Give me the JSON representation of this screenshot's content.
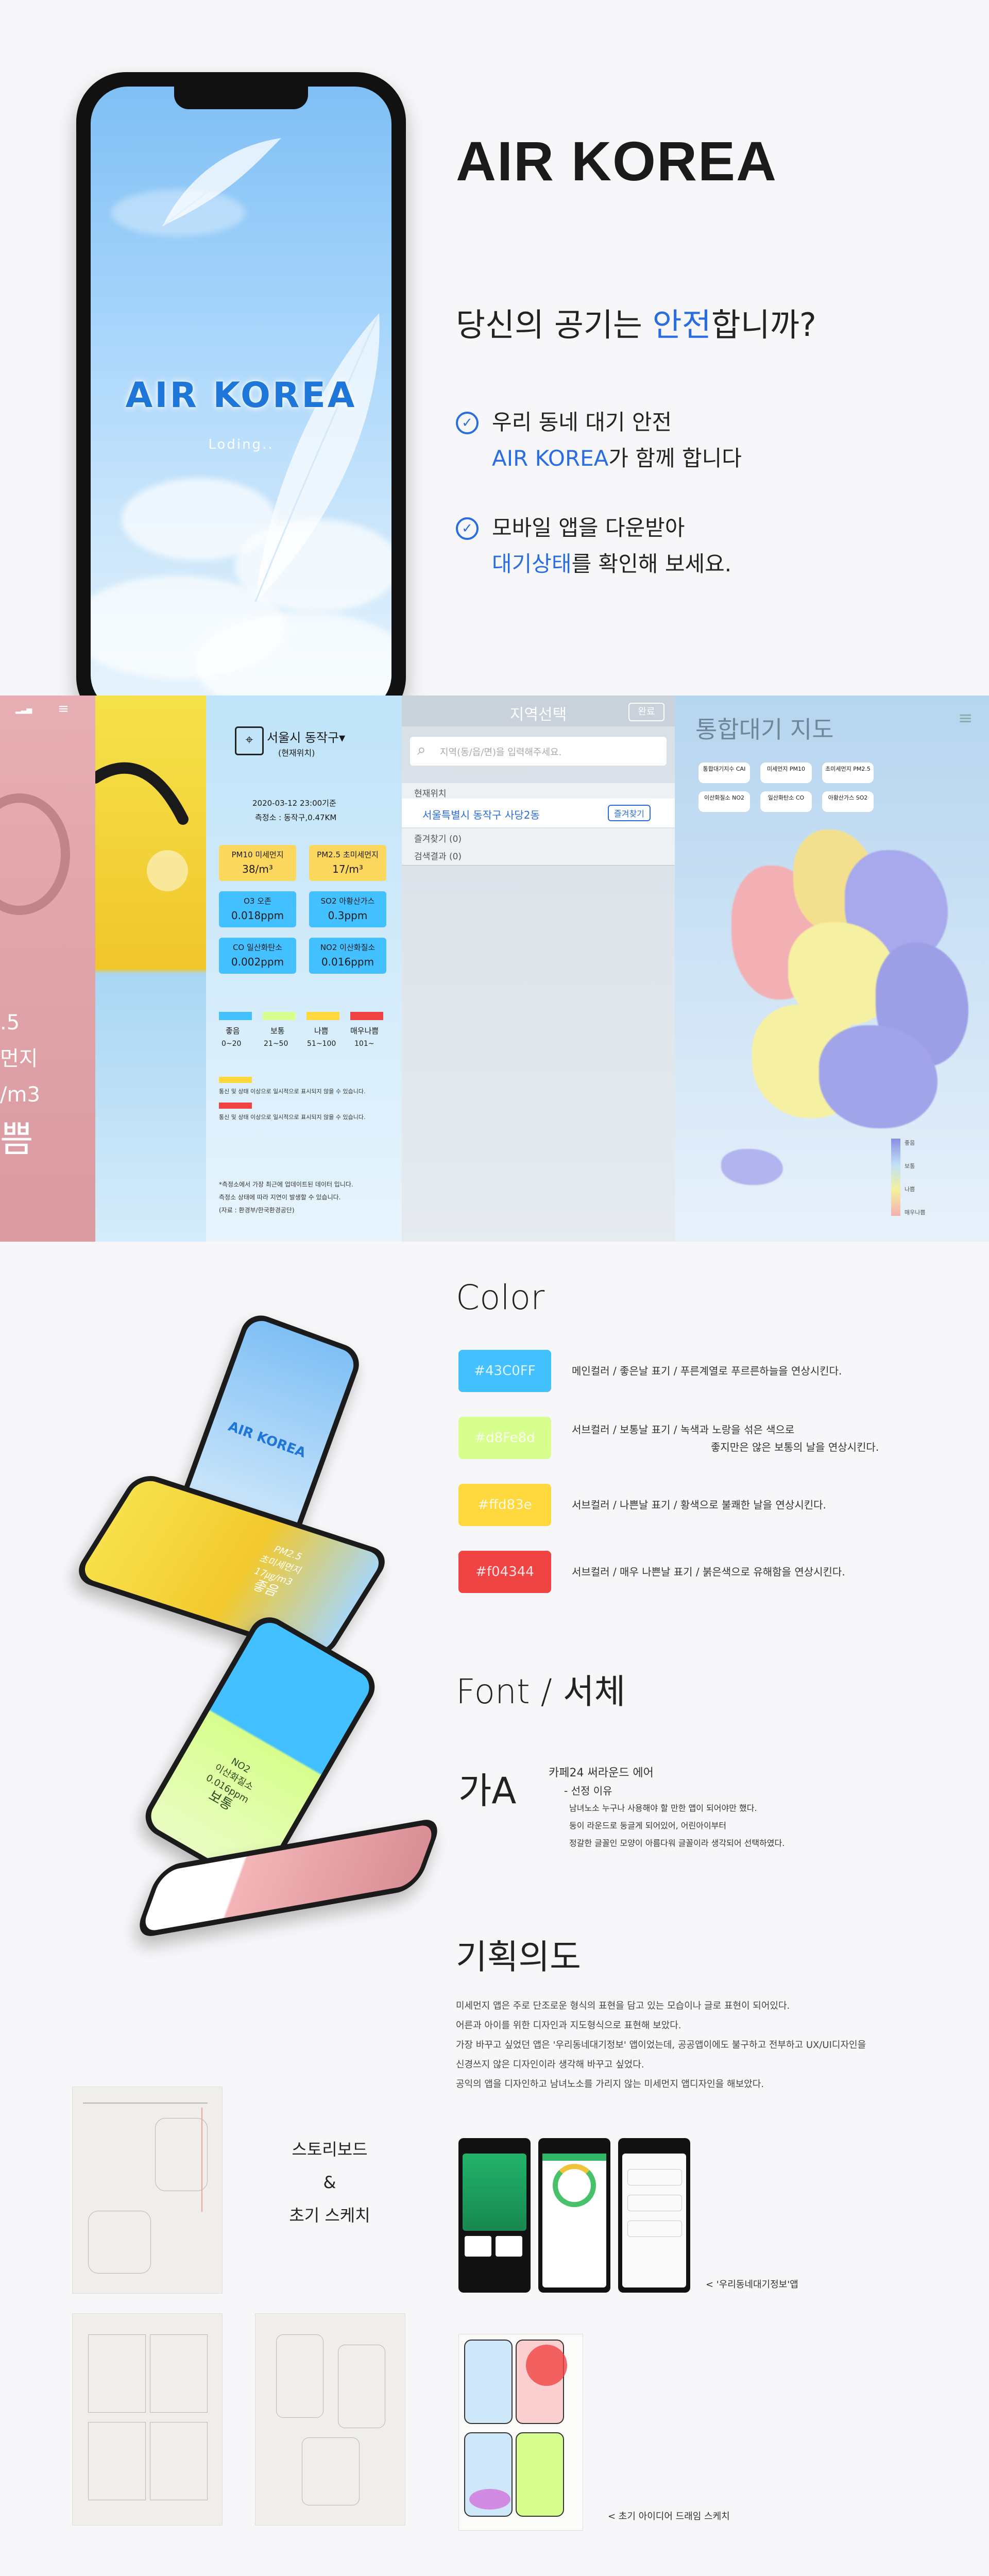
{
  "hero": {
    "app_logo": "AIR KOREA",
    "loading_text": "Loding..",
    "title": "AIR KOREA",
    "subtitle_pre": "당신의 공기는 ",
    "subtitle_accent": "안전",
    "subtitle_post": "합니까?",
    "bullets": [
      {
        "line1": "우리 동네 대기 안전",
        "line2_accent": "AIR KOREA",
        "line2_rest": "가 함께 합니다"
      },
      {
        "line1": "모바일 앱을 다운받아",
        "line2_accent": "대기상태",
        "line2_rest": "를 확인해 보세요."
      }
    ]
  },
  "screens": {
    "pink": {
      "lines": [
        ".5",
        "먼지",
        "/m3",
        "쁨"
      ]
    },
    "info": {
      "location": "서울시 동작구▾",
      "location_sub": "(현재위치)",
      "datetime": "2020-03-12 23:00기준",
      "station": "측정소 : 동작구,0.47KM",
      "items": [
        {
          "name": "PM10",
          "status": "미세먼지",
          "value": "38/m³",
          "color": "#fcd75e"
        },
        {
          "name": "PM2.5",
          "status": "초미세먼지",
          "value": "17/m³",
          "color": "#fcd75e"
        },
        {
          "name": "O3",
          "status": "오존",
          "value": "0.018ppm",
          "color": "#43c0ff"
        },
        {
          "name": "SO2",
          "status": "아황산가스",
          "value": "0.3ppm",
          "color": "#43c0ff"
        },
        {
          "name": "CO",
          "status": "일산화탄소",
          "value": "0.002ppm",
          "color": "#43c0ff"
        },
        {
          "name": "NO2",
          "status": "이산화질소",
          "value": "0.016ppm",
          "color": "#43c0ff"
        }
      ],
      "scale": [
        {
          "label": "좋음",
          "range": "0~20",
          "color": "#43c0ff"
        },
        {
          "label": "보통",
          "range": "21~50",
          "color": "#d8fe8d"
        },
        {
          "label": "나쁨",
          "range": "51~100",
          "color": "#ffd83e"
        },
        {
          "label": "매우나쁨",
          "range": "101~",
          "color": "#f04344"
        }
      ],
      "notes": [
        "통신 및 상태 이상으로 일시적으로 표시되지 않을 수 있습니다.",
        "통신 및 상태 이상으로 일시적으로 표시되지 않을 수 있습니다."
      ],
      "footer": [
        "*측정소에서 가장 최근에 업데이트된 데이터 입니다.",
        "측정소 상태에 따라 지연이 발생할 수 있습니다.",
        "(자료 : 환경부/한국환경공단)"
      ]
    },
    "region": {
      "title": "지역선택",
      "done": "완료",
      "search_placeholder": "지역(동/읍/면)을 입력해주세요.",
      "current_label": "현재위치",
      "current_value": "서울특별시 동작구 사당2동",
      "fav_button": "즐겨찾기",
      "fav_list": "즐겨찾기 (0)",
      "history": "검색결과 (0)"
    },
    "map": {
      "title": "통합대기 지도",
      "chips": [
        "통합대기지수 CAI",
        "미세먼지 PM10",
        "초미세먼지 PM2.5",
        "이산화질소 NO2",
        "일산화탄소 CO",
        "아황산가스 SO2"
      ],
      "legend": [
        "좋음",
        "보통",
        "나쁨",
        "매우나쁨"
      ]
    }
  },
  "color_section": {
    "title": "Color",
    "items": [
      {
        "hex": "#43C0FF",
        "color": "#43c0ff",
        "desc": [
          "메인컬러 / 좋은날 표기 / 푸른계열로 푸르른하늘을 연상시킨다."
        ]
      },
      {
        "hex": "#d8Fe8d",
        "color": "#d8fe8d",
        "desc": [
          "서브컬러 / 보통날 표기 / 녹색과 노랑을 섞은 색으로",
          "좋지만은 않은 보통의 날을 연상시킨다."
        ]
      },
      {
        "hex": "#ffd83e",
        "color": "#ffd83e",
        "desc": [
          "서브컬러 / 나쁜날 표기 / 황색으로 불쾌한 날을 연상시킨다."
        ]
      },
      {
        "hex": "#f04344",
        "color": "#f04344",
        "desc": [
          "서브컬러 / 매우 나쁜날 표기 / 붉은색으로 유해함을 연상시킨다."
        ]
      }
    ]
  },
  "font_section": {
    "title": "Font / 서체",
    "sample": "가A",
    "font_name": "카페24 써라운드 에어",
    "reason_title": "- 선정 이유",
    "reasons": [
      "남녀노소 누구나 사용해야 할 만한 앱이 되어야만 했다.",
      "둥이 라운드로 둥글게 되어있어, 어린아이부터",
      "정갈한 글꼴인 모양이 아름다워 글꼴이라 생각되어 선택하였다."
    ]
  },
  "plan_section": {
    "title": "기획의도",
    "lines": [
      "미세먼지 앱은 주로 단조로운 형식의 표현을 담고 있는 모습이나 글로 표현이 되어있다.",
      "어른과 아이를 위한 디자인과 지도형식으로 표현해 보았다.",
      "가장 바꾸고 싶었던 앱은 '우리동네대기정보' 앱이었는데, 공공앱이에도 불구하고 전부하고 UX/UI디자인을",
      "신경쓰지 않은 디자인이라 생각해 바꾸고 싶었다.",
      "공익의 앱을 디자인하고 남녀노소를 가리지 않는 미세먼지 앱디자인을 해보았다."
    ],
    "ref_caption": "< '우리동네대기정보'앱",
    "sketch_caption": "< 초기 아이디어 드래임 스케치"
  },
  "storyboard": {
    "label_line1": "스토리보드",
    "label_line2": "&",
    "label_line3": "초기 스케치"
  },
  "flying_phones": {
    "logo": "AIR KOREA",
    "pm25_lines": [
      "PM2.5",
      "초미세먼지",
      "17㎍/m3",
      "좋음"
    ],
    "no2_lines": [
      "NO2",
      "이산화질소",
      "0.016ppm",
      "보통"
    ]
  }
}
